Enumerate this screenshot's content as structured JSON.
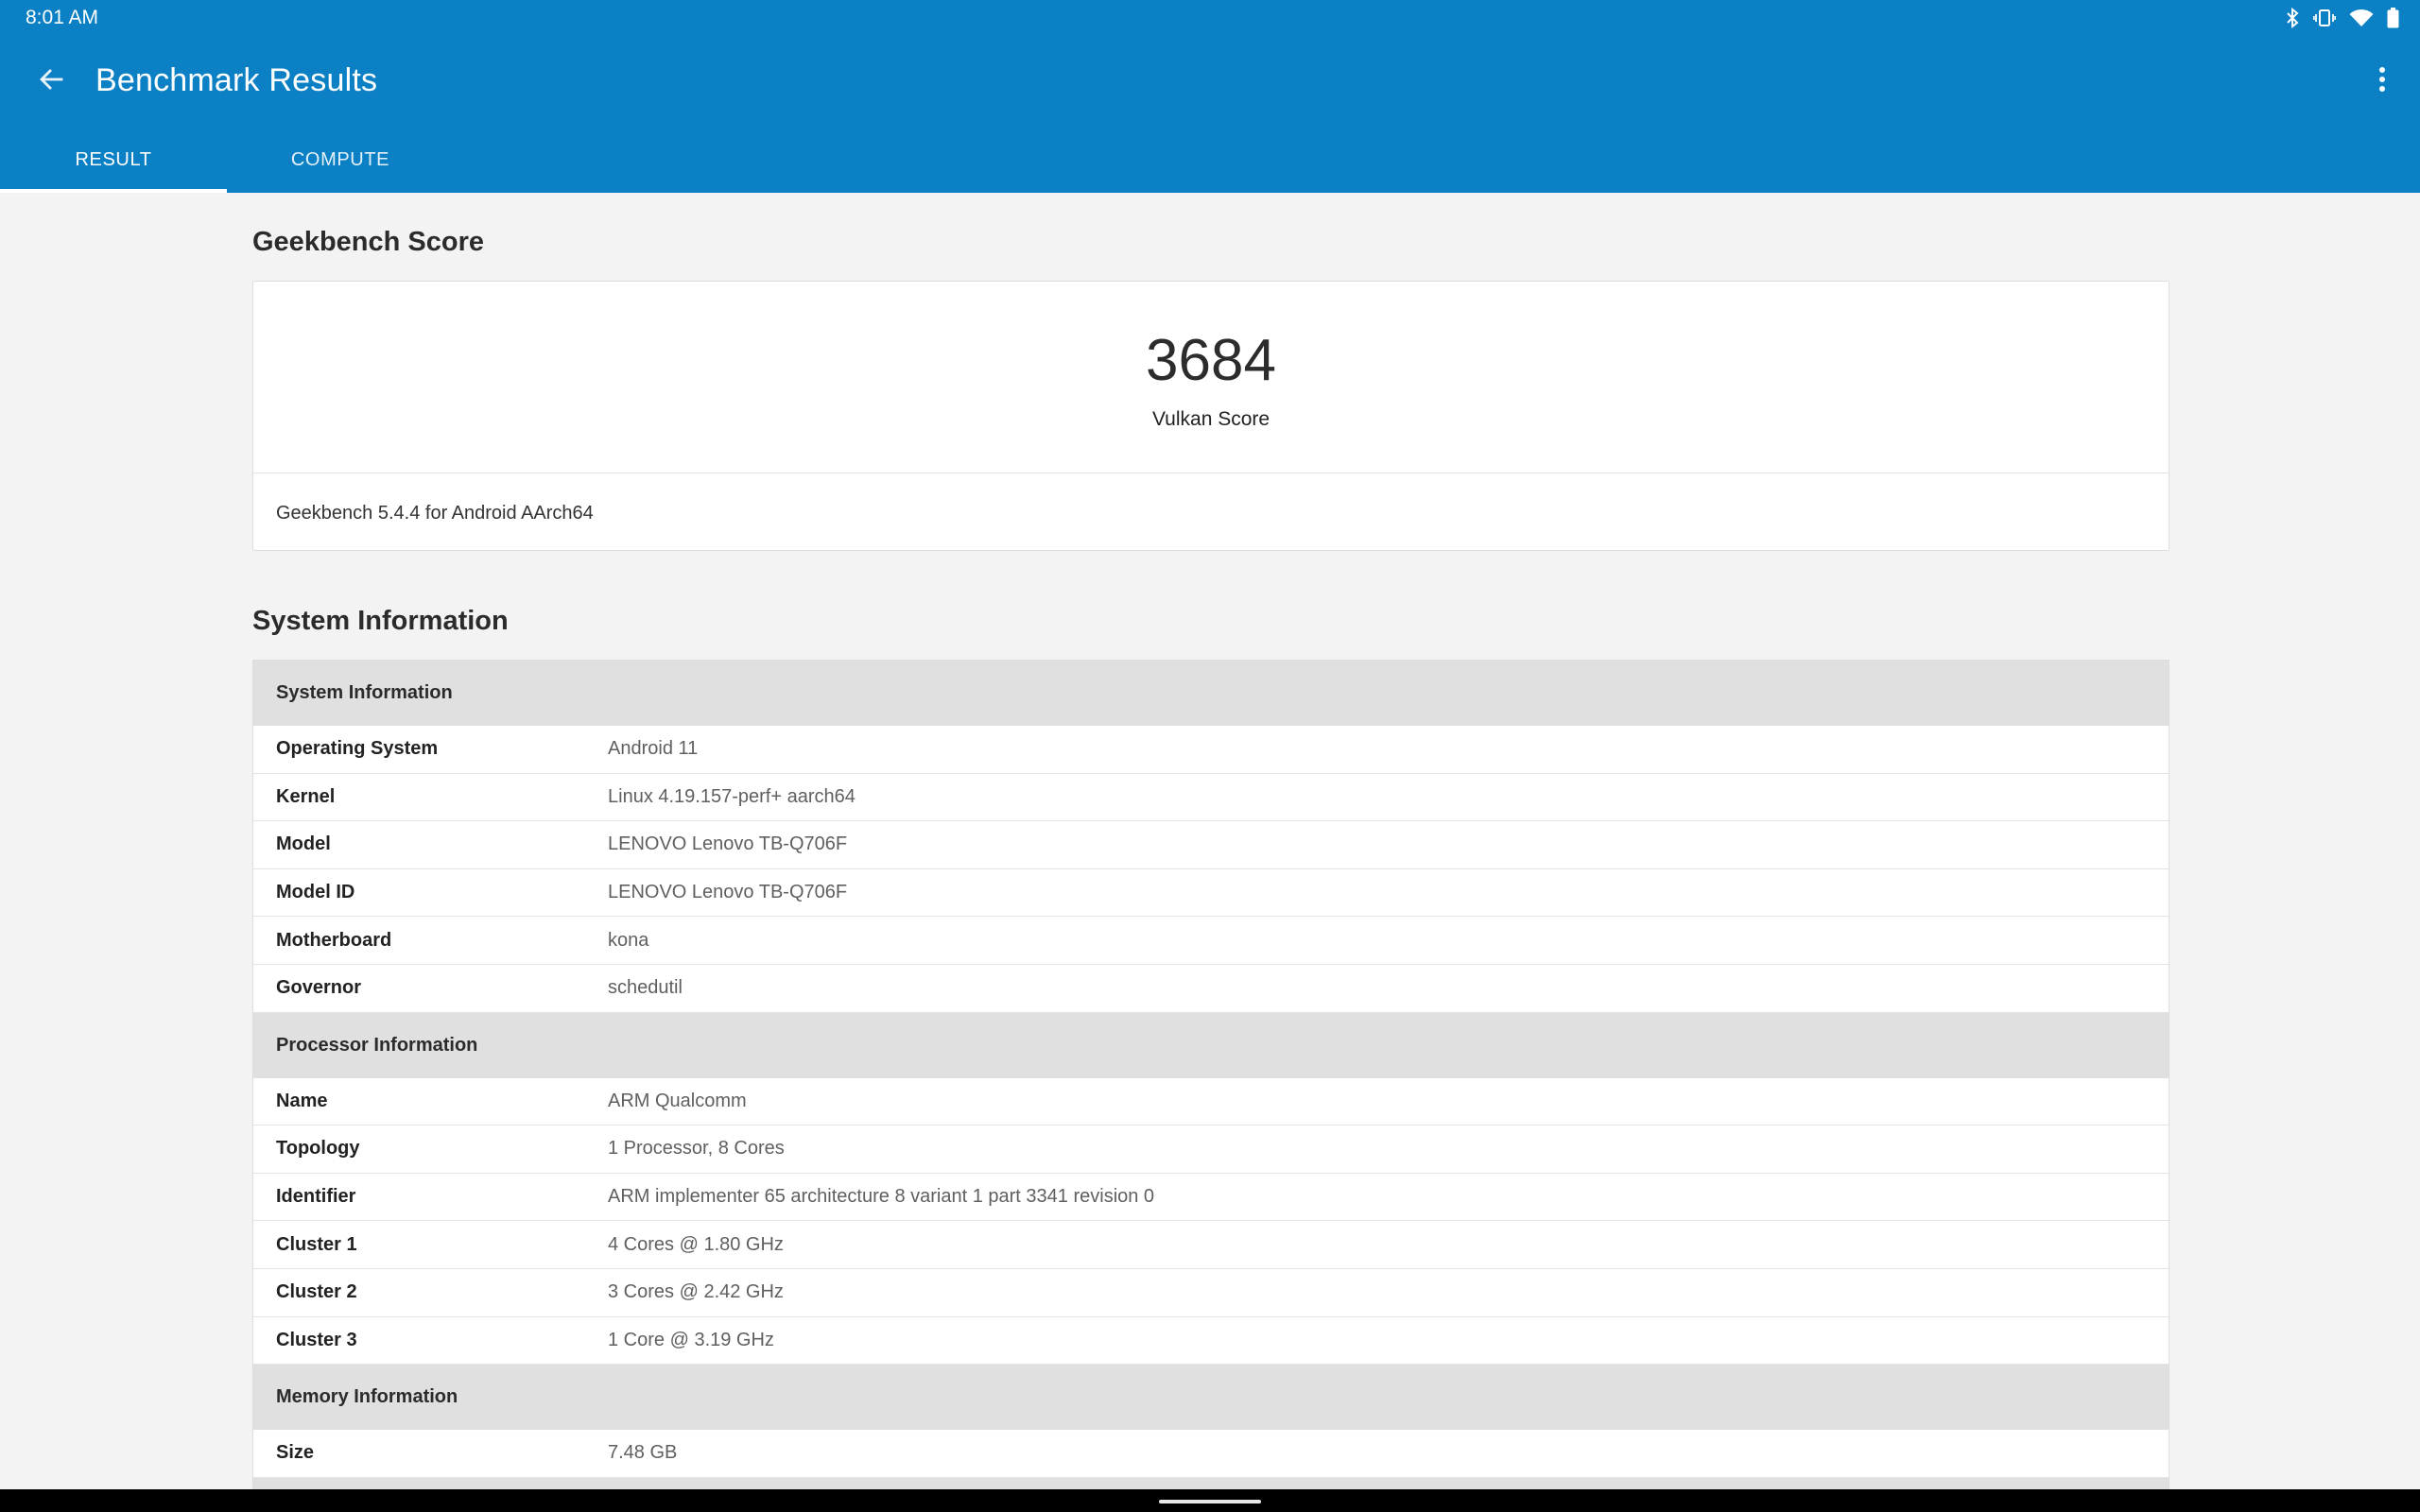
{
  "status_bar": {
    "time": "8:01 AM",
    "icons": [
      "bluetooth-icon",
      "vibrate-icon",
      "wifi-icon",
      "battery-icon"
    ]
  },
  "toolbar": {
    "title": "Benchmark Results",
    "back_icon": "arrow-back-icon",
    "overflow_icon": "more-vert-icon"
  },
  "tabs": [
    {
      "label": "RESULT",
      "active": true
    },
    {
      "label": "COMPUTE",
      "active": false
    }
  ],
  "score_section": {
    "heading": "Geekbench Score",
    "score": "3684",
    "score_label": "Vulkan Score",
    "version": "Geekbench 5.4.4 for Android AArch64"
  },
  "system_section": {
    "heading": "System Information",
    "groups": [
      {
        "title": "System Information",
        "rows": [
          {
            "key": "Operating System",
            "value": "Android 11"
          },
          {
            "key": "Kernel",
            "value": "Linux 4.19.157-perf+ aarch64"
          },
          {
            "key": "Model",
            "value": "LENOVO Lenovo TB-Q706F"
          },
          {
            "key": "Model ID",
            "value": "LENOVO Lenovo TB-Q706F"
          },
          {
            "key": "Motherboard",
            "value": "kona"
          },
          {
            "key": "Governor",
            "value": "schedutil"
          }
        ]
      },
      {
        "title": "Processor Information",
        "rows": [
          {
            "key": "Name",
            "value": "ARM Qualcomm"
          },
          {
            "key": "Topology",
            "value": "1 Processor, 8 Cores"
          },
          {
            "key": "Identifier",
            "value": "ARM implementer 65 architecture 8 variant 1 part 3341 revision 0"
          },
          {
            "key": "Cluster 1",
            "value": "4 Cores @ 1.80 GHz"
          },
          {
            "key": "Cluster 2",
            "value": "3 Cores @ 2.42 GHz"
          },
          {
            "key": "Cluster 3",
            "value": "1 Core @ 3.19 GHz"
          }
        ]
      },
      {
        "title": "Memory Information",
        "rows": [
          {
            "key": "Size",
            "value": "7.48 GB"
          }
        ]
      }
    ]
  },
  "colors": {
    "app_bar": "#0b80c4",
    "background": "#f3f3f3",
    "group_header": "#e0e0e0"
  }
}
